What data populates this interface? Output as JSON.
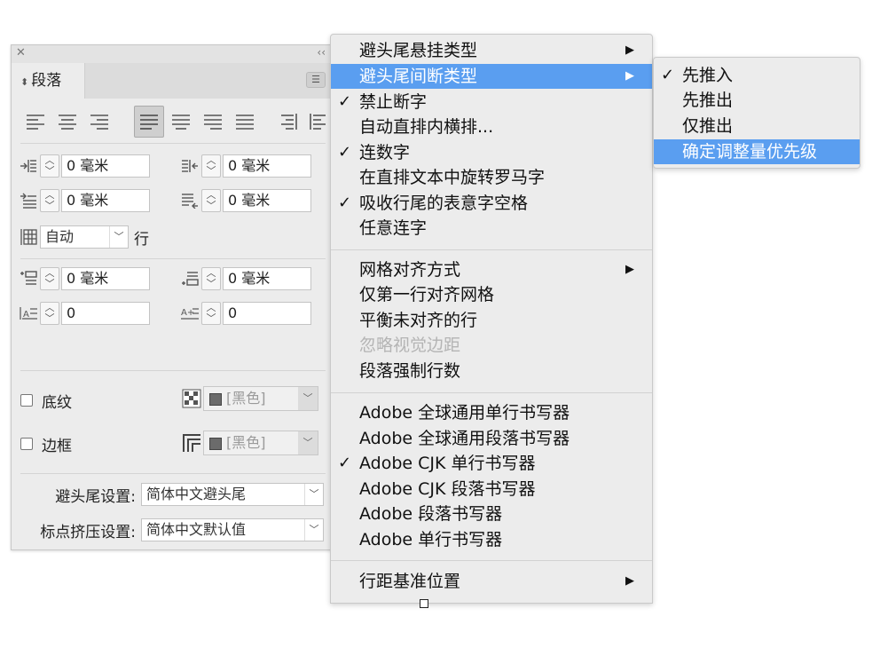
{
  "panel": {
    "close_glyph": "✕",
    "collapse_glyph": "‹‹",
    "tab_label": "段落",
    "tab_icon": "⬍",
    "menu_glyph": "☰",
    "alignment_buttons": [
      "align-left",
      "align-center",
      "align-right",
      "justify-last-left",
      "justify-last-center",
      "justify-last-right",
      "justify-all",
      "align-toward-spine",
      "align-away-from-spine"
    ],
    "left_indent": "0 毫米",
    "right_indent": "0 毫米",
    "first_line_indent": "0 毫米",
    "last_line_indent": "0 毫米",
    "grid_value": "自动",
    "grid_unit": "行",
    "space_before": "0 毫米",
    "space_after": "0 毫米",
    "drop_cap_lines": "0",
    "drop_cap_chars": "0",
    "shading_label": "底纹",
    "shading_color": "[黑色]",
    "border_label": "边框",
    "border_color": "[黑色]",
    "kinsoku_label": "避头尾设置:",
    "kinsoku_value": "简体中文避头尾",
    "mojikumi_label": "标点挤压设置:",
    "mojikumi_value": "简体中文默认值"
  },
  "menu": {
    "items": [
      {
        "label": "避头尾悬挂类型",
        "arrow": "▶"
      },
      {
        "label": "避头尾间断类型",
        "arrow": "▶"
      },
      {
        "label": "禁止断字",
        "check": "✓"
      },
      {
        "label": "自动直排内横排..."
      },
      {
        "label": "连数字",
        "check": "✓"
      },
      {
        "label": "在直排文本中旋转罗马字"
      },
      {
        "label": "吸收行尾的表意字空格",
        "check": "✓"
      },
      {
        "label": "任意连字"
      },
      {
        "label": "网格对齐方式",
        "arrow": "▶"
      },
      {
        "label": "仅第一行对齐网格"
      },
      {
        "label": "平衡未对齐的行"
      },
      {
        "label": "忽略视觉边距"
      },
      {
        "label": "段落强制行数"
      },
      {
        "label": "Adobe 全球通用单行书写器"
      },
      {
        "label": "Adobe 全球通用段落书写器"
      },
      {
        "label": "Adobe CJK 单行书写器",
        "check": "✓"
      },
      {
        "label": "Adobe CJK 段落书写器"
      },
      {
        "label": "Adobe 段落书写器"
      },
      {
        "label": "Adobe 单行书写器"
      },
      {
        "label": "行距基准位置",
        "arrow": "▶"
      }
    ]
  },
  "submenu": {
    "items": [
      {
        "label": "先推入",
        "check": "✓"
      },
      {
        "label": "先推出"
      },
      {
        "label": "仅推出"
      },
      {
        "label": "确定调整量优先级"
      }
    ]
  },
  "colors": {
    "highlight": "#5a9ef0",
    "menu_bg": "#ececec",
    "panel_bg": "#ececec",
    "disabled_text": "#b4b4b4"
  }
}
